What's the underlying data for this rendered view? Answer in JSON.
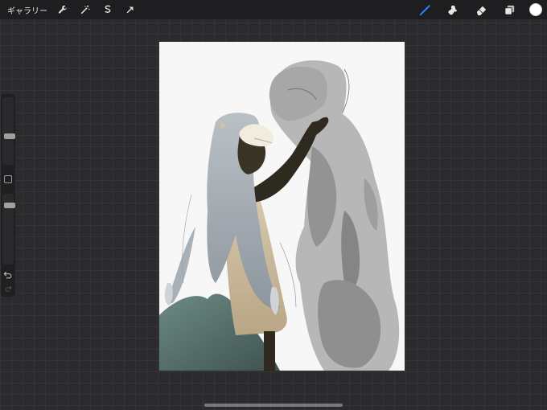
{
  "topbar": {
    "gallery_label": "ギャラリー",
    "left_icons": [
      "wrench-icon",
      "magic-wand-icon",
      "selection-icon",
      "transform-arrow-icon"
    ],
    "right_tools": [
      "brush-icon",
      "smudge-icon",
      "eraser-icon",
      "layers-icon"
    ],
    "active_tool": "brush-icon",
    "active_color": "#ffffff",
    "accent_color": "#2f7ef6"
  },
  "sidebar": {
    "brush_size_level": 0.42,
    "opacity_level": 0.14,
    "icons": [
      "modify-square-icon",
      "undo-icon",
      "redo-icon"
    ]
  }
}
